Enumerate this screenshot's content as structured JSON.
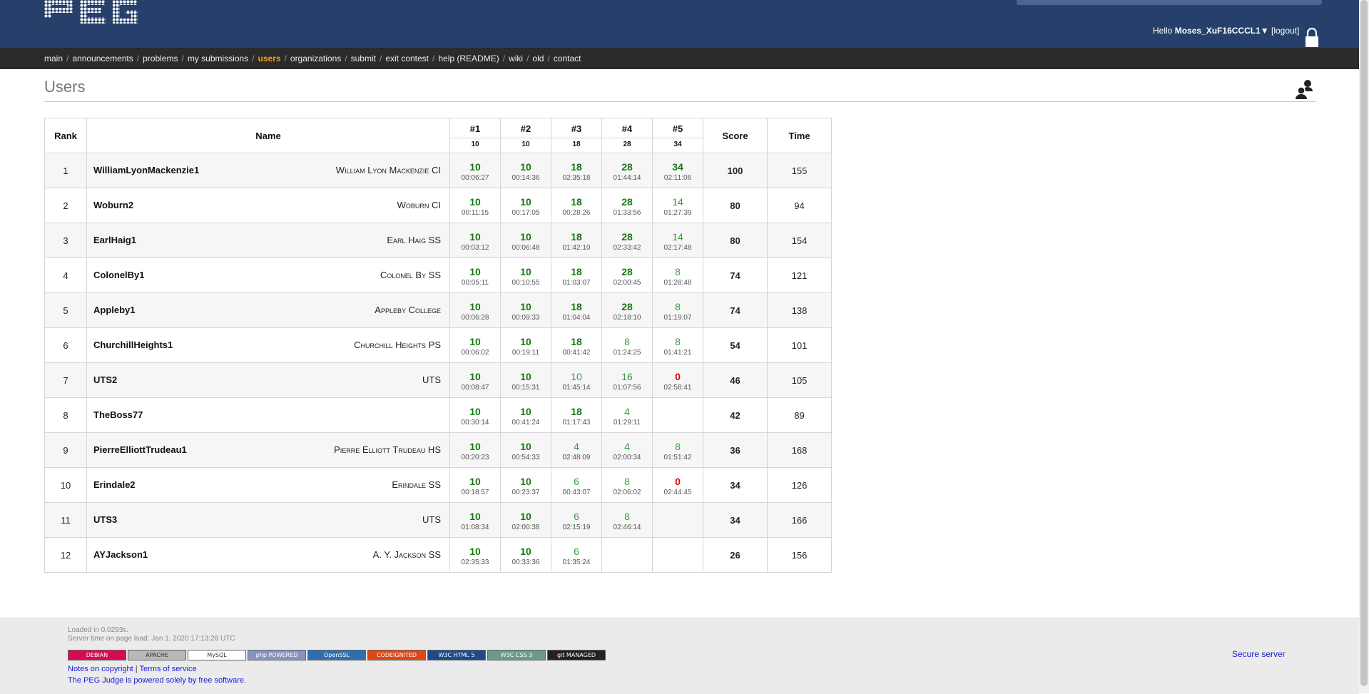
{
  "header": {
    "logo_text": "PEG",
    "greeting_prefix": "Hello",
    "username": "Moses_XuF16CCCL1",
    "user_dropdown_arrow": "▼",
    "logout_label": "[logout]"
  },
  "nav": [
    {
      "label": "main",
      "active": false
    },
    {
      "label": "announcements",
      "active": false
    },
    {
      "label": "problems",
      "active": false
    },
    {
      "label": "my submissions",
      "active": false
    },
    {
      "label": "users",
      "active": true
    },
    {
      "label": "organizations",
      "active": false
    },
    {
      "label": "submit",
      "active": false
    },
    {
      "label": "exit contest",
      "active": false
    },
    {
      "label": "help (README)",
      "active": false
    },
    {
      "label": "wiki",
      "active": false
    },
    {
      "label": "old",
      "active": false
    },
    {
      "label": "contact",
      "active": false
    }
  ],
  "page_title": "Users",
  "table": {
    "headers": {
      "rank": "Rank",
      "name": "Name",
      "score": "Score",
      "time": "Time"
    },
    "problems": [
      {
        "label": "#1",
        "points": "10"
      },
      {
        "label": "#2",
        "points": "10"
      },
      {
        "label": "#3",
        "points": "18"
      },
      {
        "label": "#4",
        "points": "28"
      },
      {
        "label": "#5",
        "points": "34"
      }
    ],
    "rows": [
      {
        "rank": "1",
        "user": "WilliamLyonMackenzie1",
        "org": "William Lyon Mackenzie CI",
        "score": "100",
        "time": "155",
        "problems": [
          {
            "points": "10",
            "time": "00:06:27",
            "state": "full"
          },
          {
            "points": "10",
            "time": "00:14:36",
            "state": "full"
          },
          {
            "points": "18",
            "time": "02:35:18",
            "state": "full"
          },
          {
            "points": "28",
            "time": "01:44:14",
            "state": "full"
          },
          {
            "points": "34",
            "time": "02:11:06",
            "state": "full"
          }
        ]
      },
      {
        "rank": "2",
        "user": "Woburn2",
        "org": "Woburn CI",
        "score": "80",
        "time": "94",
        "problems": [
          {
            "points": "10",
            "time": "00:11:15",
            "state": "full"
          },
          {
            "points": "10",
            "time": "00:17:05",
            "state": "full"
          },
          {
            "points": "18",
            "time": "00:28:26",
            "state": "full"
          },
          {
            "points": "28",
            "time": "01:33:56",
            "state": "full"
          },
          {
            "points": "14",
            "time": "01:27:39",
            "state": "partial"
          }
        ]
      },
      {
        "rank": "3",
        "user": "EarlHaig1",
        "org": "Earl Haig SS",
        "score": "80",
        "time": "154",
        "problems": [
          {
            "points": "10",
            "time": "00:03:12",
            "state": "full"
          },
          {
            "points": "10",
            "time": "00:06:48",
            "state": "full"
          },
          {
            "points": "18",
            "time": "01:42:10",
            "state": "full"
          },
          {
            "points": "28",
            "time": "02:33:42",
            "state": "full"
          },
          {
            "points": "14",
            "time": "02:17:48",
            "state": "partial"
          }
        ]
      },
      {
        "rank": "4",
        "user": "ColonelBy1",
        "org": "Colonel By SS",
        "score": "74",
        "time": "121",
        "problems": [
          {
            "points": "10",
            "time": "00:05:11",
            "state": "full"
          },
          {
            "points": "10",
            "time": "00:10:55",
            "state": "full"
          },
          {
            "points": "18",
            "time": "01:03:07",
            "state": "full"
          },
          {
            "points": "28",
            "time": "02:00:45",
            "state": "full"
          },
          {
            "points": "8",
            "time": "01:28:48",
            "state": "partial"
          }
        ]
      },
      {
        "rank": "5",
        "user": "Appleby1",
        "org": "Appleby College",
        "score": "74",
        "time": "138",
        "problems": [
          {
            "points": "10",
            "time": "00:06:28",
            "state": "full"
          },
          {
            "points": "10",
            "time": "00:09:33",
            "state": "full"
          },
          {
            "points": "18",
            "time": "01:04:04",
            "state": "full"
          },
          {
            "points": "28",
            "time": "02:18:10",
            "state": "full"
          },
          {
            "points": "8",
            "time": "01:19:07",
            "state": "partial"
          }
        ]
      },
      {
        "rank": "6",
        "user": "ChurchillHeights1",
        "org": "Churchill Heights PS",
        "score": "54",
        "time": "101",
        "problems": [
          {
            "points": "10",
            "time": "00:06:02",
            "state": "full"
          },
          {
            "points": "10",
            "time": "00:19:11",
            "state": "full"
          },
          {
            "points": "18",
            "time": "00:41:42",
            "state": "full"
          },
          {
            "points": "8",
            "time": "01:24:25",
            "state": "partial"
          },
          {
            "points": "8",
            "time": "01:41:21",
            "state": "partial"
          }
        ]
      },
      {
        "rank": "7",
        "user": "UTS2",
        "org": "UTS",
        "score": "46",
        "time": "105",
        "problems": [
          {
            "points": "10",
            "time": "00:08:47",
            "state": "full"
          },
          {
            "points": "10",
            "time": "00:15:31",
            "state": "full"
          },
          {
            "points": "10",
            "time": "01:45:14",
            "state": "partial"
          },
          {
            "points": "16",
            "time": "01:07:56",
            "state": "partial"
          },
          {
            "points": "0",
            "time": "02:58:41",
            "state": "zero"
          }
        ]
      },
      {
        "rank": "8",
        "user": "TheBoss77",
        "org": "",
        "score": "42",
        "time": "89",
        "problems": [
          {
            "points": "10",
            "time": "00:30:14",
            "state": "full"
          },
          {
            "points": "10",
            "time": "00:41:24",
            "state": "full"
          },
          {
            "points": "18",
            "time": "01:17:43",
            "state": "full"
          },
          {
            "points": "4",
            "time": "01:29:11",
            "state": "partial"
          },
          {
            "points": "",
            "time": "",
            "state": "none"
          }
        ]
      },
      {
        "rank": "9",
        "user": "PierreElliottTrudeau1",
        "org": "Pierre Elliott Trudeau HS",
        "score": "36",
        "time": "168",
        "problems": [
          {
            "points": "10",
            "time": "00:20:23",
            "state": "full"
          },
          {
            "points": "10",
            "time": "00:54:33",
            "state": "full"
          },
          {
            "points": "4",
            "time": "02:48:09",
            "state": "partial"
          },
          {
            "points": "4",
            "time": "02:00:34",
            "state": "partial"
          },
          {
            "points": "8",
            "time": "01:51:42",
            "state": "partial"
          }
        ]
      },
      {
        "rank": "10",
        "user": "Erindale2",
        "org": "Erindale SS",
        "score": "34",
        "time": "126",
        "problems": [
          {
            "points": "10",
            "time": "00:18:57",
            "state": "full"
          },
          {
            "points": "10",
            "time": "00:23:37",
            "state": "full"
          },
          {
            "points": "6",
            "time": "00:43:07",
            "state": "partial"
          },
          {
            "points": "8",
            "time": "02:06:02",
            "state": "partial"
          },
          {
            "points": "0",
            "time": "02:44:45",
            "state": "zero"
          }
        ]
      },
      {
        "rank": "11",
        "user": "UTS3",
        "org": "UTS",
        "score": "34",
        "time": "166",
        "problems": [
          {
            "points": "10",
            "time": "01:08:34",
            "state": "full"
          },
          {
            "points": "10",
            "time": "02:00:38",
            "state": "full"
          },
          {
            "points": "6",
            "time": "02:15:19",
            "state": "partial"
          },
          {
            "points": "8",
            "time": "02:46:14",
            "state": "partial"
          },
          {
            "points": "",
            "time": "",
            "state": "none"
          }
        ]
      },
      {
        "rank": "12",
        "user": "AYJackson1",
        "org": "A. Y. Jackson SS",
        "score": "26",
        "time": "156",
        "problems": [
          {
            "points": "10",
            "time": "02:35:33",
            "state": "full"
          },
          {
            "points": "10",
            "time": "00:33:36",
            "state": "full"
          },
          {
            "points": "6",
            "time": "01:35:24",
            "state": "partial"
          },
          {
            "points": "",
            "time": "",
            "state": "none"
          },
          {
            "points": "",
            "time": "",
            "state": "none"
          }
        ]
      }
    ]
  },
  "footer": {
    "loaded": "Loaded in 0.0293s.",
    "server_time": "Server time on page load: Jan 1, 2020 17:13:28 UTC",
    "badges": [
      {
        "label": "DEBIAN",
        "color": "#d70a53"
      },
      {
        "label": "APACHE",
        "color": "#b8b8b8"
      },
      {
        "label": "MySQL",
        "color": "#ffffff"
      },
      {
        "label": "php POWERED",
        "color": "#8892bf"
      },
      {
        "label": "OpenSSL",
        "color": "#2f6fb0"
      },
      {
        "label": "CODEIGNITED",
        "color": "#dd4814"
      },
      {
        "label": "W3C HTML 5",
        "color": "#1e4a8a"
      },
      {
        "label": "W3C CSS 3",
        "color": "#6a9a8a"
      },
      {
        "label": "git MANAGED",
        "color": "#222222"
      }
    ],
    "copyright_link": "Notes on copyright",
    "separator": "|",
    "terms_link": "Terms of service",
    "powered_by": "The PEG Judge is powered solely by free software.",
    "secure_server": "Secure server"
  },
  "colors": {
    "header_bg": "#26406b",
    "nav_bg": "#2b2b2b",
    "nav_active": "#f0a020",
    "full_score": "#16790e",
    "partial_score": "#3c9a3c",
    "zero_score": "#e00000",
    "link": "#1a1ad6"
  }
}
